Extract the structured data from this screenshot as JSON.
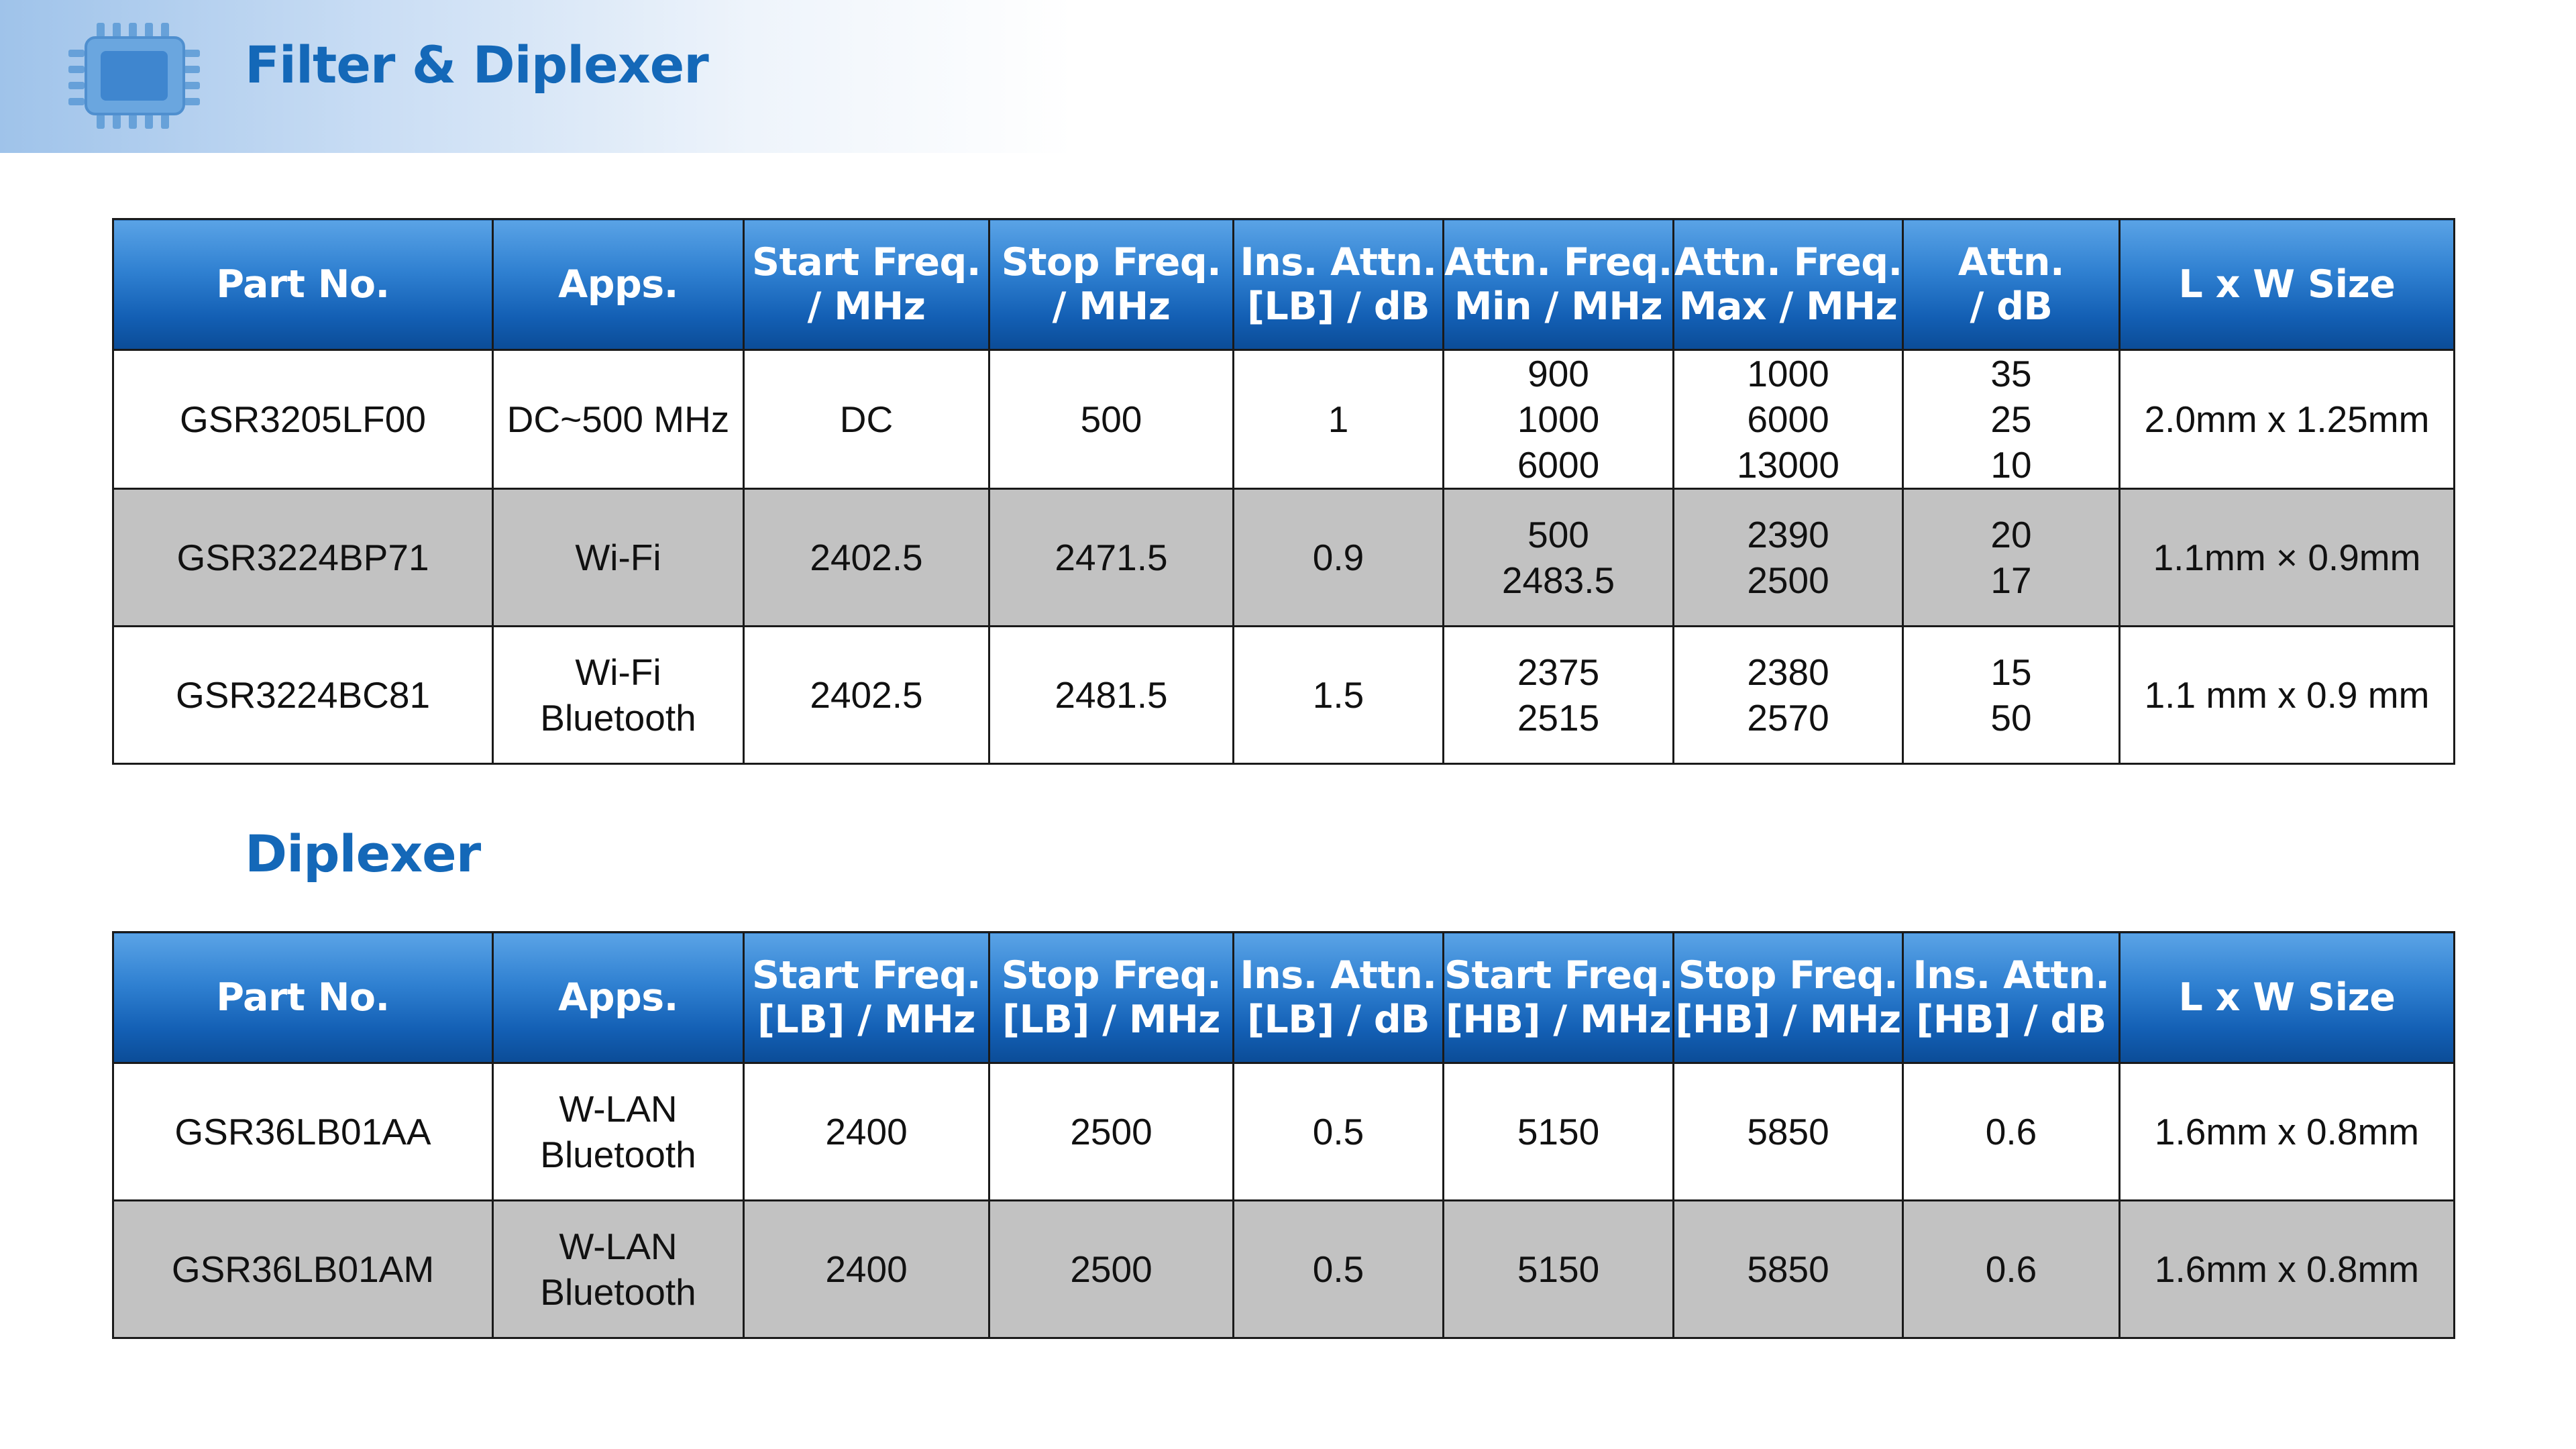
{
  "header": {
    "title": "Filter & Diplexer",
    "icon": "chip-icon",
    "accent_color": "#1468b8"
  },
  "filter_table": {
    "columns": [
      [
        "Part No."
      ],
      [
        "Apps."
      ],
      [
        "Start Freq.",
        "/ MHz"
      ],
      [
        "Stop Freq.",
        "/ MHz"
      ],
      [
        "Ins. Attn.",
        "[LB] / dB"
      ],
      [
        "Attn. Freq.",
        "Min / MHz"
      ],
      [
        "Attn. Freq.",
        "Max / MHz"
      ],
      [
        "Attn.",
        "/ dB"
      ],
      [
        "L x W Size"
      ]
    ],
    "rows": [
      {
        "style": "white",
        "cells": [
          [
            "GSR3205LF00"
          ],
          [
            "DC~500 MHz"
          ],
          [
            "DC"
          ],
          [
            "500"
          ],
          [
            "1"
          ],
          [
            "900",
            "1000",
            "6000"
          ],
          [
            "1000",
            "6000",
            "13000"
          ],
          [
            "35",
            "25",
            "10"
          ],
          [
            "2.0mm x 1.25mm"
          ]
        ]
      },
      {
        "style": "gray",
        "cells": [
          [
            "GSR3224BP71"
          ],
          [
            "Wi-Fi"
          ],
          [
            "2402.5"
          ],
          [
            "2471.5"
          ],
          [
            "0.9"
          ],
          [
            "500",
            "2483.5"
          ],
          [
            "2390",
            "2500"
          ],
          [
            "20",
            "17"
          ],
          [
            "1.1mm × 0.9mm"
          ]
        ]
      },
      {
        "style": "white",
        "cells": [
          [
            "GSR3224BC81"
          ],
          [
            "Wi-Fi",
            "Bluetooth"
          ],
          [
            "2402.5"
          ],
          [
            "2481.5"
          ],
          [
            "1.5"
          ],
          [
            "2375",
            "2515"
          ],
          [
            "2380",
            "2570"
          ],
          [
            "15",
            "50"
          ],
          [
            "1.1 mm x 0.9 mm"
          ]
        ]
      }
    ]
  },
  "diplexer_section": {
    "title": "Diplexer"
  },
  "diplexer_table": {
    "columns": [
      [
        "Part No."
      ],
      [
        "Apps."
      ],
      [
        "Start Freq.",
        "[LB] / MHz"
      ],
      [
        "Stop Freq.",
        "[LB] / MHz"
      ],
      [
        "Ins. Attn.",
        "[LB] / dB"
      ],
      [
        "Start Freq.",
        "[HB] / MHz"
      ],
      [
        "Stop Freq.",
        "[HB] / MHz"
      ],
      [
        "Ins. Attn.",
        "[HB] / dB"
      ],
      [
        "L x W Size"
      ]
    ],
    "rows": [
      {
        "style": "white",
        "cells": [
          [
            "GSR36LB01AA"
          ],
          [
            "W-LAN",
            "Bluetooth"
          ],
          [
            "2400"
          ],
          [
            "2500"
          ],
          [
            "0.5"
          ],
          [
            "5150"
          ],
          [
            "5850"
          ],
          [
            "0.6"
          ],
          [
            "1.6mm x 0.8mm"
          ]
        ]
      },
      {
        "style": "gray",
        "cells": [
          [
            "GSR36LB01AM"
          ],
          [
            "W-LAN",
            "Bluetooth"
          ],
          [
            "2400"
          ],
          [
            "2500"
          ],
          [
            "0.5"
          ],
          [
            "5150"
          ],
          [
            "5850"
          ],
          [
            "0.6"
          ],
          [
            "1.6mm x 0.8mm"
          ]
        ]
      }
    ]
  }
}
